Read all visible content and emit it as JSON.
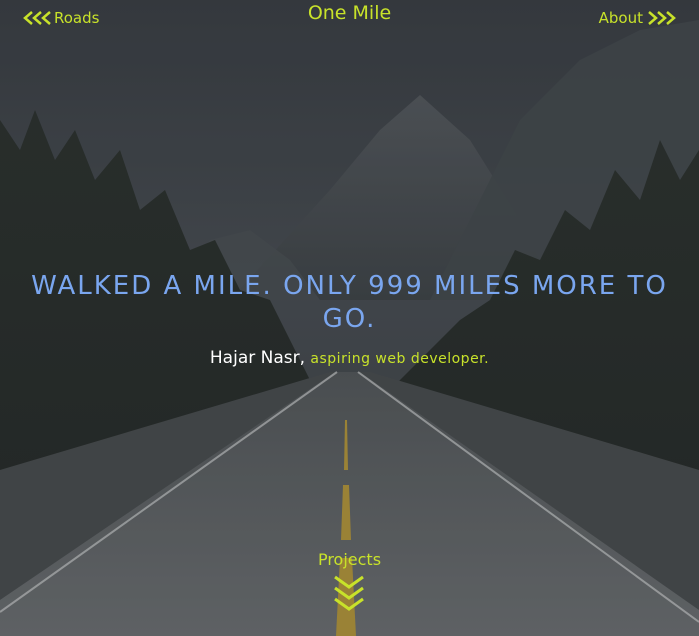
{
  "nav": {
    "left_label": "Roads",
    "right_label": "About",
    "brand": "One Mile"
  },
  "hero": {
    "title": "WALKED A MILE. ONLY 999 MILES MORE TO GO.",
    "name": "Hajar Nasr,",
    "role": "aspiring web developer."
  },
  "footer": {
    "projects_label": "Projects"
  },
  "icons": {
    "left_nav": "triple-chevron-left-icon",
    "right_nav": "triple-chevron-right-icon",
    "down": "triple-chevron-down-icon"
  },
  "colors": {
    "accent": "#c8e22a",
    "title": "#7aa6ef",
    "text": "#ffffff"
  }
}
